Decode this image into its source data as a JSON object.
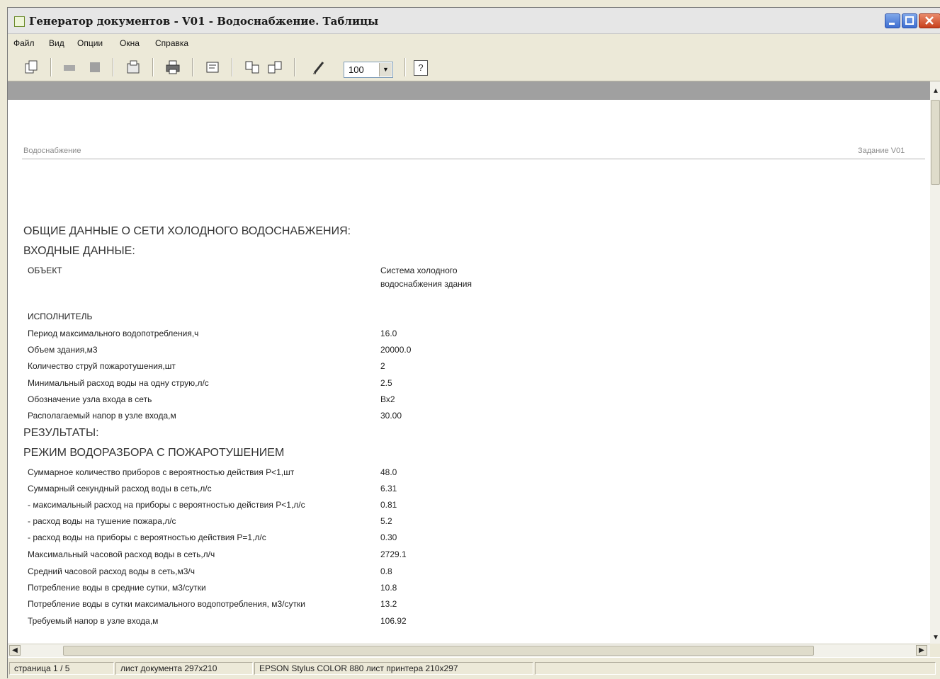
{
  "window": {
    "title": "Генератор документов - V01 - Водоснабжение. Таблицы"
  },
  "menu": [
    "Файл",
    "Вид",
    "Опции",
    "Окна",
    "Справка"
  ],
  "toolbar": {
    "icons": [
      "copy-doc-icon",
      "move-left-icon",
      "stop-icon",
      "properties-icon",
      "print-icon",
      "printer-setup-icon",
      "page-prev-icon",
      "page-next-icon",
      "pencil-icon",
      "help-icon"
    ],
    "zoom": "100",
    "help_glyph": "?"
  },
  "document": {
    "header_left": "Водоснабжение",
    "header_right": "Задание   V01",
    "section_general": "ОБЩИЕ ДАННЫЕ О СЕТИ ХОЛОДНОГО ВОДОСНАБЖЕНИЯ:",
    "section_input": "ВХОДНЫЕ ДАННЫЕ:",
    "object_label": "ОБЪЕКТ",
    "object_value_line1": "Система холодного",
    "object_value_line2": "водоснабжения здания",
    "executor_label": "ИСПОЛНИТЕЛЬ",
    "input_rows": [
      {
        "label": "Период максимального водопотребления,ч",
        "value": "16.0"
      },
      {
        "label": "Объем здания,м3",
        "value": "20000.0"
      },
      {
        "label": "Количество струй пожаротушения,шт",
        "value": "2"
      },
      {
        "label": "Минимальный расход воды на одну струю,л/с",
        "value": "2.5"
      },
      {
        "label": "Обозначение узла входа в сеть",
        "value": "Вх2"
      },
      {
        "label": "Располагаемый напор в узле входа,м",
        "value": "30.00"
      }
    ],
    "section_results": "РЕЗУЛЬТАТЫ:",
    "section_mode": "РЕЖИМ ВОДОРАЗБОРА С ПОЖАРОТУШЕНИЕМ",
    "result_rows": [
      {
        "label": "Суммарное количество приборов с вероятностью действия P<1,шт",
        "value": "48.0"
      },
      {
        "label": "Суммарный секундный расход воды в сеть,л/с",
        "value": "6.31"
      },
      {
        "label": "- максимальный расход на приборы с вероятностью действия P<1,л/с",
        "value": "0.81"
      },
      {
        "label": "- расход воды на тушение пожара,л/с",
        "value": "5.2"
      },
      {
        "label": "- расход воды на приборы с вероятностью действия P=1,л/с",
        "value": "0.30"
      },
      {
        "label": "Максимальный часовой расход воды в сеть,л/ч",
        "value": "2729.1"
      },
      {
        "label": "Средний часовой расход воды в сеть,м3/ч",
        "value": "0.8"
      },
      {
        "label": "Потребление воды в средние сутки, м3/сутки",
        "value": "10.8"
      },
      {
        "label": "Потребление воды в сутки максимального водопотребления, м3/сутки",
        "value": "13.2"
      },
      {
        "label": "Требуемый напор в узле входа,м",
        "value": "106.92"
      }
    ]
  },
  "status": {
    "page": "страница 1 / 5",
    "doc_sheet": "лист документа 297x210",
    "printer": "EPSON Stylus COLOR 880  лист принтера 210x297"
  }
}
